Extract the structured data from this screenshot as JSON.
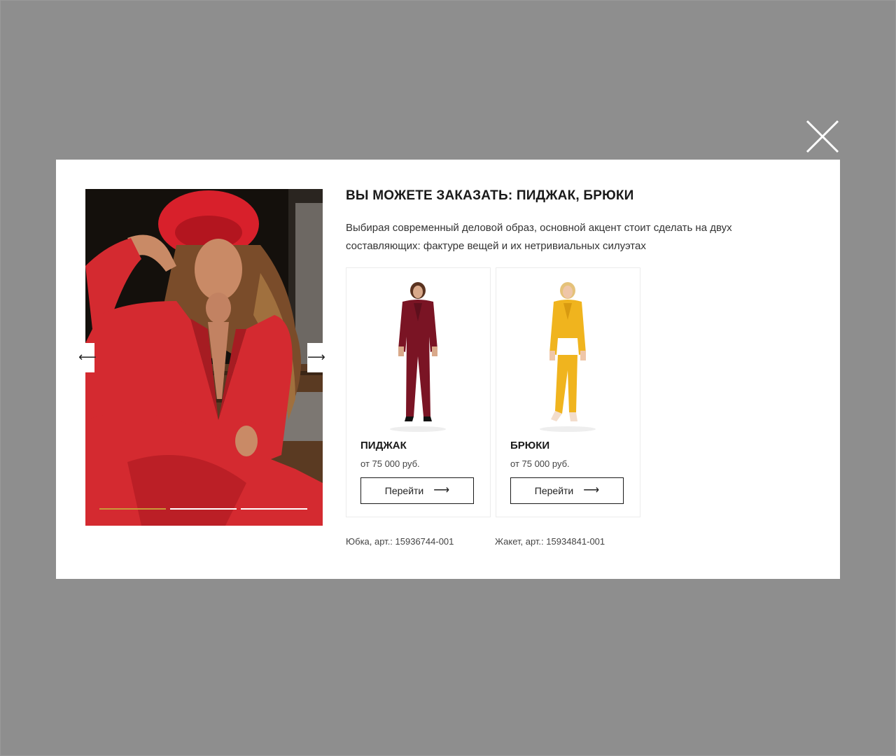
{
  "modal": {
    "title": "ВЫ МОЖЕТЕ ЗАКАЗАТЬ: ПИДЖАК, БРЮКИ",
    "description": "Выбирая современный деловой образ, основной акцент стоит сделать на двух составляющих: фактуре вещей и их нетривиальных силуэтах",
    "close_icon": "close-icon"
  },
  "slider": {
    "prev_label": "⟵",
    "next_label": "⟶",
    "slides_count": 3,
    "active_index": 0,
    "accent_color": "#c89a3a",
    "main_color": "#d42a30"
  },
  "cards": [
    {
      "name": "ПИДЖАК",
      "price": "от 75 000 руб.",
      "button_label": "Перейти",
      "color": "#7a1424"
    },
    {
      "name": "БРЮКИ",
      "price": "от 75 000 руб.",
      "button_label": "Перейти",
      "color": "#f0b41e"
    }
  ],
  "articles": [
    "Юбка, арт.: 15936744-001",
    "Жакет, арт.: 15934841-001"
  ]
}
